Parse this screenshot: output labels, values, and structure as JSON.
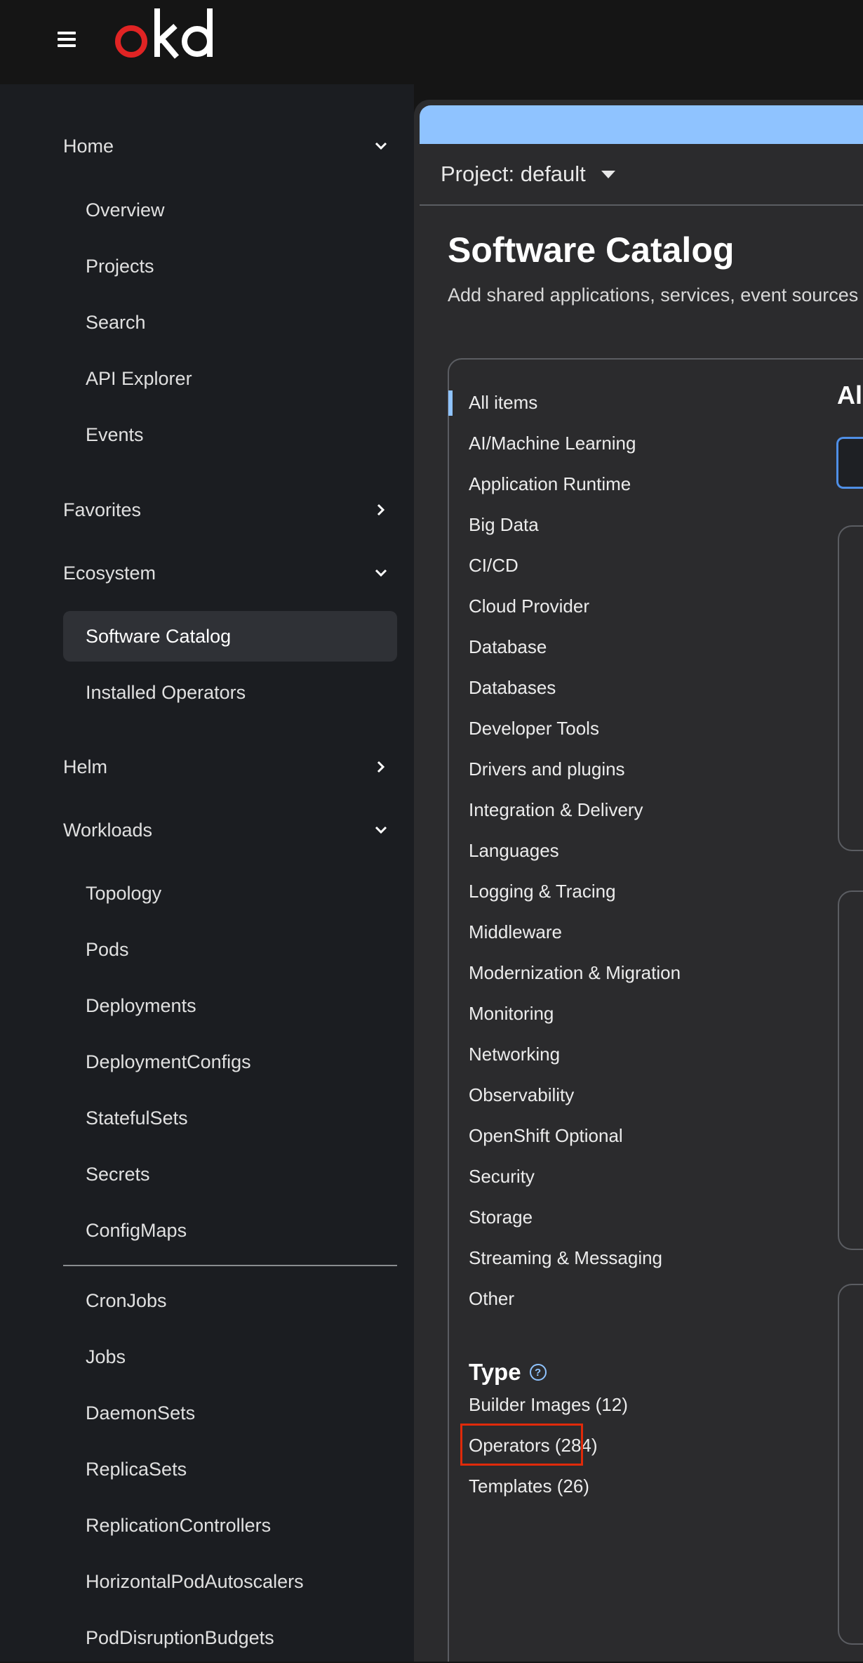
{
  "brand": {
    "logo_text": "okd",
    "logo_o_color": "#e02424"
  },
  "sidebar": {
    "sections": [
      {
        "label": "Home",
        "expanded": true,
        "items": [
          "Overview",
          "Projects",
          "Search",
          "API Explorer",
          "Events"
        ]
      },
      {
        "label": "Favorites",
        "expanded": false
      },
      {
        "label": "Ecosystem",
        "expanded": true,
        "items": [
          "Software Catalog",
          "Installed Operators"
        ],
        "active_item": "Software Catalog"
      },
      {
        "label": "Helm",
        "expanded": false
      },
      {
        "label": "Workloads",
        "expanded": true,
        "items": [
          "Topology",
          "Pods",
          "Deployments",
          "DeploymentConfigs",
          "StatefulSets",
          "Secrets",
          "ConfigMaps",
          "CronJobs",
          "Jobs",
          "DaemonSets",
          "ReplicaSets",
          "ReplicationControllers",
          "HorizontalPodAutoscalers",
          "PodDisruptionBudgets"
        ]
      }
    ]
  },
  "project": {
    "label": "Project: default"
  },
  "page": {
    "title": "Software Catalog",
    "subtitle": "Add shared applications, services, event sources"
  },
  "categories": {
    "items": [
      "All items",
      "AI/Machine Learning",
      "Application Runtime",
      "Big Data",
      "CI/CD",
      "Cloud Provider",
      "Database",
      "Databases",
      "Developer Tools",
      "Drivers and plugins",
      "Integration & Delivery",
      "Languages",
      "Logging & Tracing",
      "Middleware",
      "Modernization & Migration",
      "Monitoring",
      "Networking",
      "Observability",
      "OpenShift Optional",
      "Security",
      "Storage",
      "Streaming & Messaging",
      "Other"
    ],
    "active": "All items"
  },
  "type_filter": {
    "heading": "Type",
    "options": [
      "Builder Images (12)",
      "Operators (284)",
      "Templates (26)"
    ],
    "highlighted": "Operators (284)"
  },
  "right_panel": {
    "heading": "All"
  },
  "colors": {
    "accent": "#8fc3ff",
    "highlight": "#e02a0a",
    "background": "#151515"
  }
}
